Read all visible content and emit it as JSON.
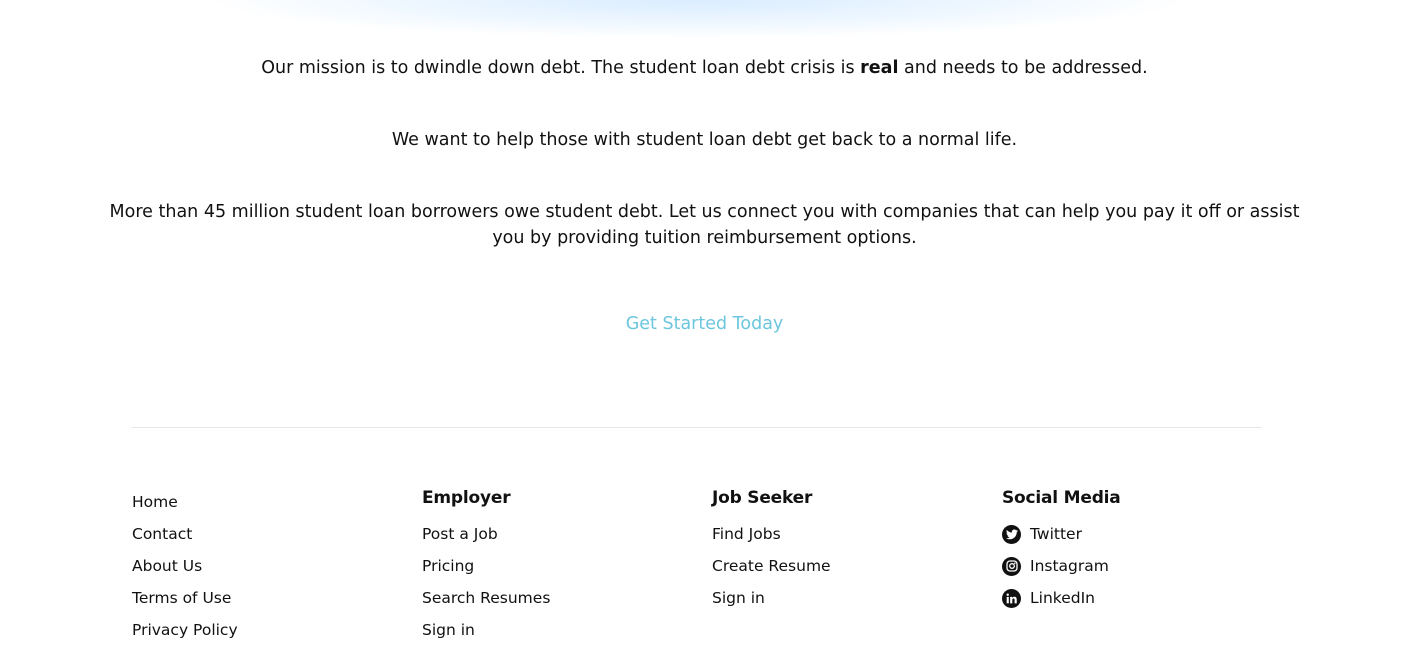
{
  "mission": {
    "line1_before": "Our mission is to dwindle down debt. The student loan debt crisis is ",
    "line1_bold": "real",
    "line1_after": " and needs to be addressed.",
    "line2": "We want to help those with student loan debt get back to a normal life.",
    "line3a": "More than 45 million student loan borrowers owe student debt. Let us connect you with companies that can help you pay it off or assist",
    "line3b": "you by providing tuition reimbursement options."
  },
  "cta": {
    "label": "Get Started Today",
    "color": "#6cc6dd"
  },
  "footer": {
    "general": {
      "links": [
        "Home",
        "Contact",
        "About Us",
        "Terms of Use",
        "Privacy Policy"
      ]
    },
    "employer": {
      "title": "Employer",
      "links": [
        "Post a Job",
        "Pricing",
        "Search Resumes",
        "Sign in"
      ]
    },
    "job_seeker": {
      "title": "Job Seeker",
      "links": [
        "Find Jobs",
        "Create Resume",
        "Sign in"
      ]
    },
    "social": {
      "title": "Social Media",
      "links": [
        {
          "label": "Twitter",
          "icon": "twitter-icon"
        },
        {
          "label": "Instagram",
          "icon": "instagram-icon"
        },
        {
          "label": "LinkedIn",
          "icon": "linkedin-icon"
        }
      ]
    }
  }
}
